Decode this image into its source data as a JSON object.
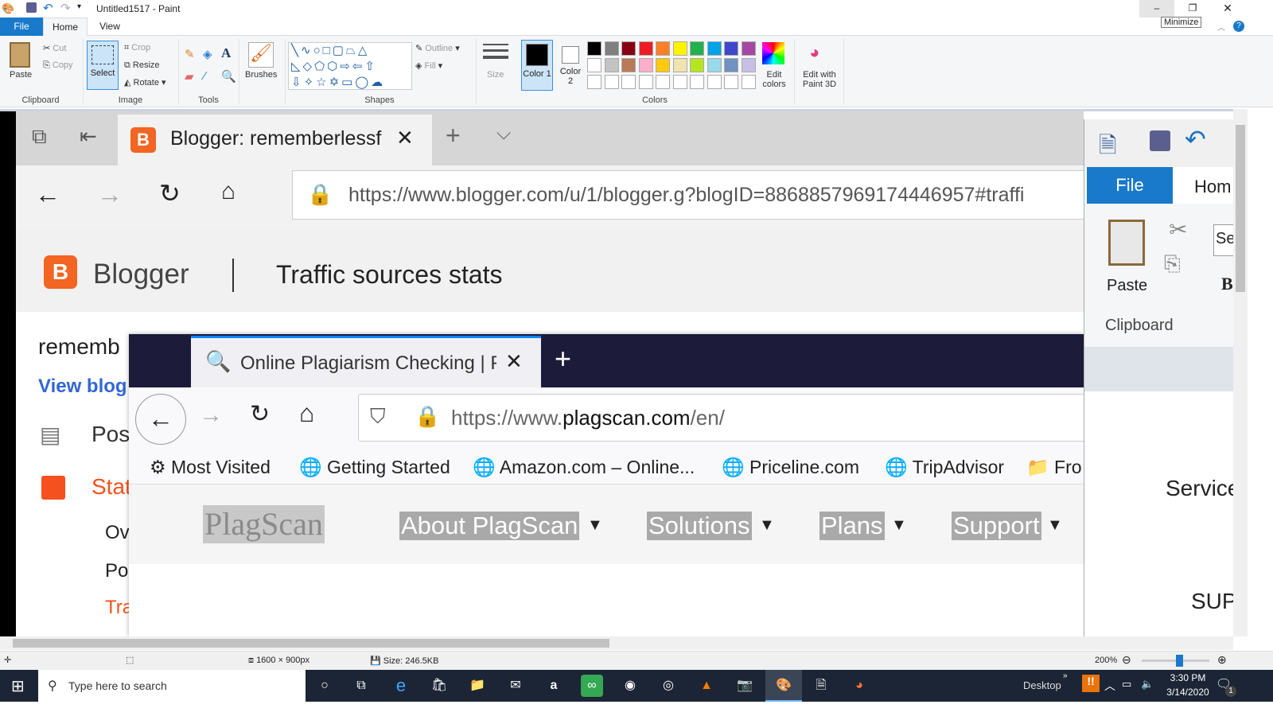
{
  "paint": {
    "title": "Untitled1517 - Paint",
    "tabs": [
      "File",
      "Home",
      "View"
    ],
    "minimize_tooltip": "Minimize",
    "clipboard": {
      "paste": "Paste",
      "cut": "Cut",
      "copy": "Copy",
      "label": "Clipboard"
    },
    "image": {
      "select": "Select",
      "crop": "Crop",
      "resize": "Resize",
      "rotate": "Rotate",
      "label": "Image"
    },
    "tools": {
      "label": "Tools"
    },
    "brushes": "Brushes",
    "shapes": {
      "outline": "Outline",
      "fill": "Fill",
      "label": "Shapes"
    },
    "size": "Size",
    "color1": "Color 1",
    "color2": "Color 2",
    "colors_label": "Colors",
    "edit_colors": "Edit colors",
    "edit_paint3d": "Edit with Paint 3D",
    "palette": [
      "#000000",
      "#7f7f7f",
      "#880015",
      "#ed1c24",
      "#ff7f27",
      "#fff200",
      "#22b14c",
      "#00a2e8",
      "#3f48cc",
      "#a349a4",
      "#ffffff",
      "#c3c3c3",
      "#b97a57",
      "#ffaec9",
      "#ffc90e",
      "#efe4b0",
      "#b5e61d",
      "#99d9ea",
      "#7092be",
      "#c8bfe7"
    ],
    "status": {
      "dimensions": "1600 × 900px",
      "size": "Size: 246.5KB",
      "zoom": "200%",
      "zoom_level": 200
    }
  },
  "edge": {
    "tab_title": "Blogger: rememberlessf",
    "url": "https://www.blogger.com/u/1/blogger.g?blogID=8868857969174446957#traffi"
  },
  "blogger": {
    "brand": "Blogger",
    "page_title": "Traffic sources stats",
    "blog_name": "rememb",
    "view_blog": "View blog",
    "nav": [
      "Pos",
      "Stat",
      "Ov",
      "Po",
      "Tra"
    ]
  },
  "firefox": {
    "tab_title": "Online Plagiarism Checking | P",
    "url_prefix": "https://www.",
    "url_domain": "plagscan.com",
    "url_suffix": "/en/",
    "bookmarks": [
      "Most Visited",
      "Getting Started",
      "Amazon.com – Online...",
      "Priceline.com",
      "TripAdvisor",
      "Fro"
    ],
    "logo": "PlagScan",
    "menu": [
      "About PlagScan",
      "Solutions",
      "Plans",
      "Support"
    ]
  },
  "word": {
    "file": "File",
    "home": "Hom",
    "paste": "Paste",
    "clipboard": "Clipboard",
    "se": "Se",
    "b": "B",
    "service": "Service",
    "sup": "SUPI"
  },
  "taskbar": {
    "search_placeholder": "Type here to search",
    "desktop": "Desktop",
    "time": "3:30 PM",
    "date": "3/14/2020",
    "notifications": "1"
  }
}
